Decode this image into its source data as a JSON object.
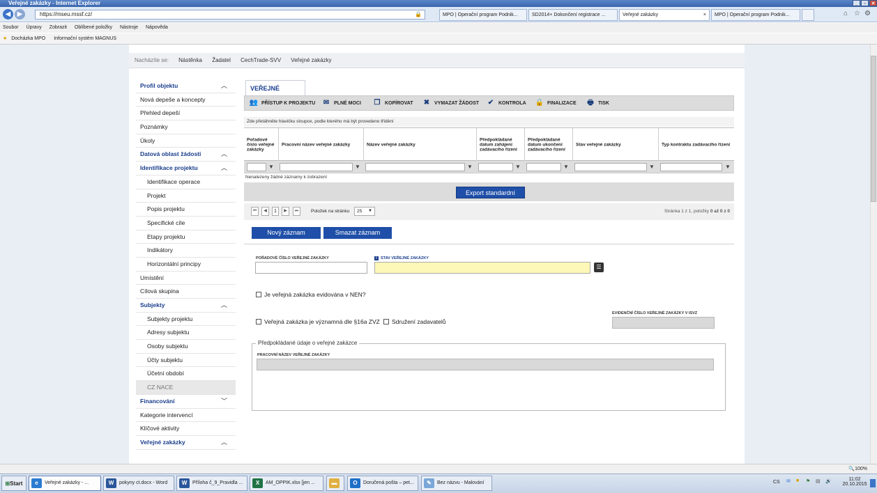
{
  "window": {
    "title": "Veřejné zakázky - Internet Explorer"
  },
  "browser": {
    "url": "https://mseu.mssf.cz/",
    "tabs": [
      {
        "label": "MPO | Operační program Podnik..."
      },
      {
        "label": "SD2014+ Dokončení registrace ..."
      },
      {
        "label": "Veřejné zakázky"
      },
      {
        "label": "MPO | Operační program Podnik..."
      }
    ],
    "menu": [
      "Soubor",
      "Úpravy",
      "Zobrazit",
      "Oblíbené položky",
      "Nástroje",
      "Nápověda"
    ],
    "favorites": [
      "Docházka MPO",
      "Informační systém MAGNUS"
    ],
    "zoom": "100%"
  },
  "breadcrumb": {
    "prefix": "Nacházíte se:",
    "items": [
      "Nástěnka",
      "Žadatel",
      "CechTrade-SVV",
      "Veřejné zakázky"
    ]
  },
  "sidebar": {
    "items": [
      {
        "label": "Profil objektu",
        "chev": "︿"
      },
      {
        "label": "Nová depeše a koncepty"
      },
      {
        "label": "Přehled depeší"
      },
      {
        "label": "Poznámky"
      },
      {
        "label": "Úkoly"
      },
      {
        "label": "Datová oblast žádosti",
        "chev": "︿"
      },
      {
        "label": "Identifikace projektu",
        "chev": "︿"
      },
      {
        "label": "Identifikace operace"
      },
      {
        "label": "Projekt"
      },
      {
        "label": "Popis projektu"
      },
      {
        "label": "Specifické cíle"
      },
      {
        "label": "Etapy projektu"
      },
      {
        "label": "Indikátory"
      },
      {
        "label": "Horizontální principy"
      },
      {
        "label": "Umístění"
      },
      {
        "label": "Cílová skupina"
      },
      {
        "label": "Subjekty",
        "chev": "︿"
      },
      {
        "label": "Subjekty projektu"
      },
      {
        "label": "Adresy subjektu"
      },
      {
        "label": "Osoby subjektu"
      },
      {
        "label": "Účty subjektu"
      },
      {
        "label": "Účetní období"
      },
      {
        "label": "CZ NACE"
      },
      {
        "label": "Financování",
        "chev": "﹀"
      },
      {
        "label": "Kategorie intervencí"
      },
      {
        "label": "Klíčové aktivity"
      },
      {
        "label": "Veřejné zakázky",
        "chev": "︿"
      }
    ]
  },
  "main": {
    "tab_label": "VEŘEJNÉ ZAKÁZKY",
    "toolbar": {
      "access": "PŘÍSTUP K PROJEKTU",
      "poa": "PLNÉ MOCI",
      "copy": "KOPÍROVAT",
      "delete": "VYMAZAT ŽÁDOST",
      "check": "KONTROLA",
      "finalize": "FINALIZACE",
      "print": "TISK"
    },
    "grid": {
      "hint": "Zde přetáhněte hlavičku sloupce, podle kterého má být provedeno třídění",
      "columns": [
        "Pořadové číslo veřejné zakázky",
        "Pracovní název veřejné zakázky",
        "Název veřejné zakázky",
        "Předpokládané datum zahájení zadávacího řízení",
        "Předpokládané datum ukončení zadávacího řízení",
        "Stav veřejné zakázky",
        "Typ kontraktu zadávacího řízení"
      ],
      "empty": "Nenalezeny žádné záznamy k zobrazení",
      "export_label": "Export standardní",
      "pager": {
        "page": "1",
        "page_size_label": "Položek na stránku",
        "page_size": "25",
        "summary_prefix": "Stránka 1 z 1, položky ",
        "summary_range": "0 až 0 z 0"
      }
    },
    "buttons": {
      "new": "Nový záznam",
      "delete": "Smazat záznam"
    },
    "form": {
      "order_label": "POŘADOVÉ ČÍSLO VEŘEJNÉ ZAKÁZKY",
      "state_label": "STAV VEŘEJNÉ ZAKÁZKY",
      "nen_label": "Je veřejná zakázka evidována v NEN?",
      "significant_label": "Veřejná zakázka je významná dle §16a ZVZ",
      "assoc_label": "Sdružení zadavatelů",
      "isvz_label": "EVIDENČNÍ ČÍSLO VEŘEJNÉ ZAKÁZKY V ISVZ",
      "fieldset_legend": "Předpokládané údaje o veřejné zakázce",
      "working_name_label": "PRACOVNÍ NÁZEV VEŘEJNÉ ZAKÁZKY"
    }
  },
  "taskbar": {
    "start": "Start",
    "tasks": [
      {
        "label": "Veřejné zakázky - ...",
        "icon": "ie-icon"
      },
      {
        "label": "pokyny ct.docx - Word",
        "icon": "word-icon"
      },
      {
        "label": "Příloha č_9_Pravidla ...",
        "icon": "word-icon"
      },
      {
        "label": "AM_OPPIK.xlsx [jen ...",
        "icon": "excel-icon"
      },
      {
        "label": "",
        "icon": "folder-icon"
      },
      {
        "label": "Doručená pošta – pet...",
        "icon": "outlook-icon"
      },
      {
        "label": "Bez názvu - Malování",
        "icon": "paint-icon"
      }
    ],
    "lang": "CS",
    "time": "11:02",
    "date": "20.10.2015"
  }
}
